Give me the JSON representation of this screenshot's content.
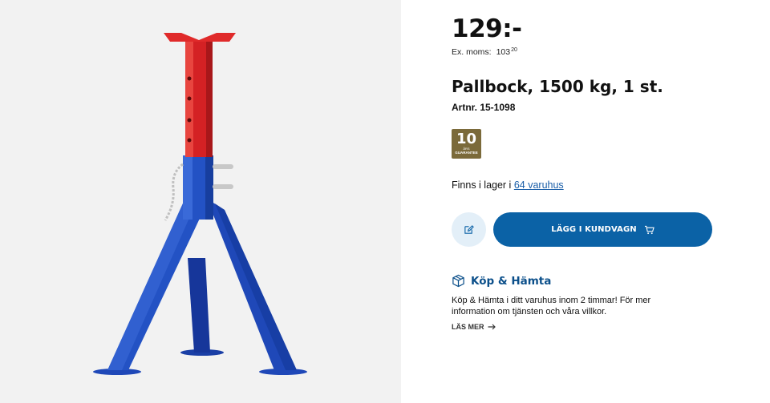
{
  "product": {
    "image_alt": "Pallbock, 1500 kg",
    "price": "129:-",
    "ex_moms_label": "Ex. moms:",
    "ex_moms_value": "103",
    "ex_moms_decimals": "20",
    "title": "Pallbock, 1500 kg, 1 st.",
    "artnr": "Artnr. 15-1098",
    "guarantee": {
      "number": "10",
      "unit": "ÅRS",
      "label": "GUARANTEE"
    }
  },
  "stock": {
    "text": "Finns i lager i",
    "link": "64 varuhus"
  },
  "actions": {
    "note_icon": "pencil-note-icon",
    "cart_label": "LÄGG I KUNDVAGN",
    "cart_icon": "cart-icon"
  },
  "pickup": {
    "icon": "box-icon",
    "title": "Köp & Hämta",
    "description": "Köp & Hämta i ditt varuhus inom 2 timmar! För mer information om tjänsten och våra villkor.",
    "read_more": "LÄS MER",
    "read_more_icon": "arrow-right-icon"
  },
  "colors": {
    "primary": "#0b62a6",
    "link": "#1a5ea8",
    "stand_red": "#d42124",
    "stand_blue": "#1f48b8",
    "guarantee_bg": "#7b6a3a"
  }
}
